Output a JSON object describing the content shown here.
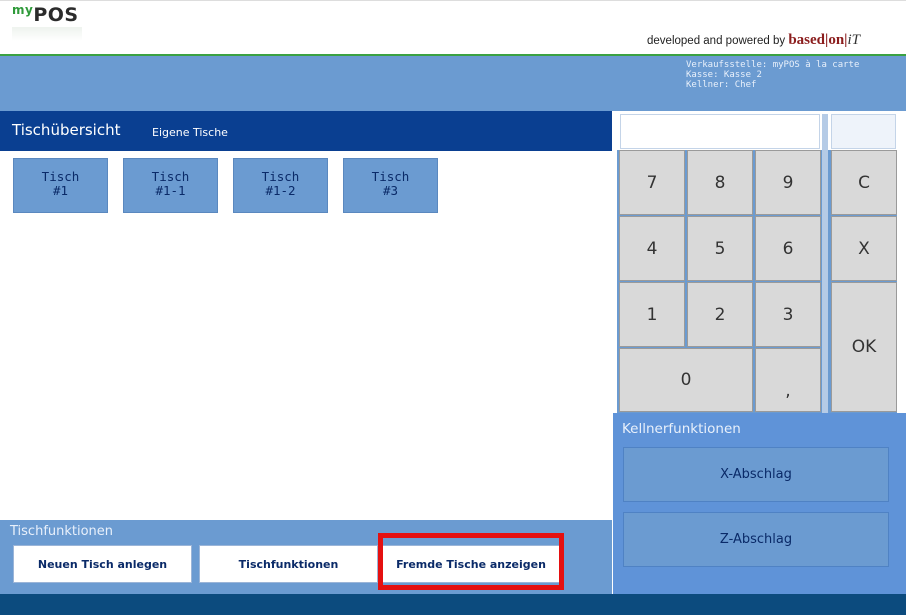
{
  "header": {
    "logo_prefix": "my",
    "logo_main": "POS",
    "powered_text": "developed and powered by",
    "brand": "based",
    "brand2": "on",
    "brand3": "iT"
  },
  "info": {
    "line1": "Verkaufsstelle: myPOS à la carte",
    "line2": "Kasse: Kasse 2",
    "line3": "Kellner: Chef"
  },
  "title_bar": {
    "title": "Tischübersicht",
    "subtitle": "Eigene Tische"
  },
  "tables": [
    {
      "line1": "Tisch",
      "line2": "#1"
    },
    {
      "line1": "Tisch",
      "line2": "#1-1"
    },
    {
      "line1": "Tisch",
      "line2": "#1-2"
    },
    {
      "line1": "Tisch",
      "line2": "#3"
    }
  ],
  "functions": {
    "label": "Tischfunktionen",
    "buttons": [
      "Neuen Tisch anlegen",
      "Tischfunktionen",
      "Fremde Tische anzeigen"
    ]
  },
  "keypad": {
    "keys": [
      "7",
      "8",
      "9",
      "C",
      "4",
      "5",
      "6",
      "X",
      "1",
      "2",
      "3",
      "OK",
      "0",
      ","
    ]
  },
  "kellner": {
    "label": "Kellnerfunktionen",
    "buttons": [
      "X-Abschlag",
      "Z-Abschlag"
    ]
  },
  "highlight_color": "#e51010",
  "accent_color": "#0a3f91"
}
